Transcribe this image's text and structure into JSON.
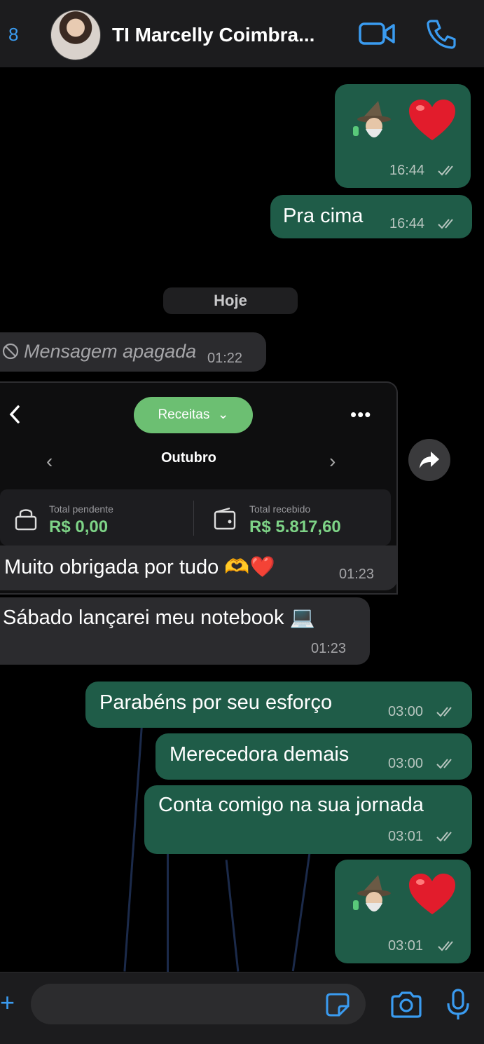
{
  "header": {
    "back_count": "8",
    "contact_name": "TI Marcelly Coimbra..."
  },
  "colors": {
    "accent": "#3a9bf0",
    "outgoing_bubble": "#1f5c48",
    "incoming_bubble": "#2b2b2e",
    "pill_green": "#6cbf72",
    "value_green": "#7ed487"
  },
  "messages": {
    "m1_time": "16:44",
    "m2_text": "Pra cima",
    "m2_time": "16:44",
    "date_chip": "Hoje",
    "deleted_text": "Mensagem apagada",
    "deleted_time": "01:22",
    "card": {
      "pill_label": "Receitas",
      "month": "Outubro",
      "pending_label": "Total pendente",
      "pending_value": "R$ 0,00",
      "received_label": "Total recebido",
      "received_value": "R$ 5.817,60"
    },
    "m3_text": "Muito obrigada por tudo 🫶❤️",
    "m3_time": "01:23",
    "m4_text": "Sábado lançarei meu notebook 💻",
    "m4_time": "01:23",
    "m5_text": "Parabéns por seu esforço",
    "m5_time": "03:00",
    "m6_text": "Merecedora demais",
    "m6_time": "03:00",
    "m7_text": "Conta comigo na sua jornada",
    "m7_time": "03:01",
    "m8_time": "03:01"
  },
  "icons": [
    "video-icon",
    "phone-icon",
    "forward-icon",
    "sticker-icon",
    "camera-icon",
    "microphone-icon",
    "plus-icon",
    "double-check-icon",
    "deleted-icon",
    "heart-emoji",
    "wizard-emoji"
  ]
}
